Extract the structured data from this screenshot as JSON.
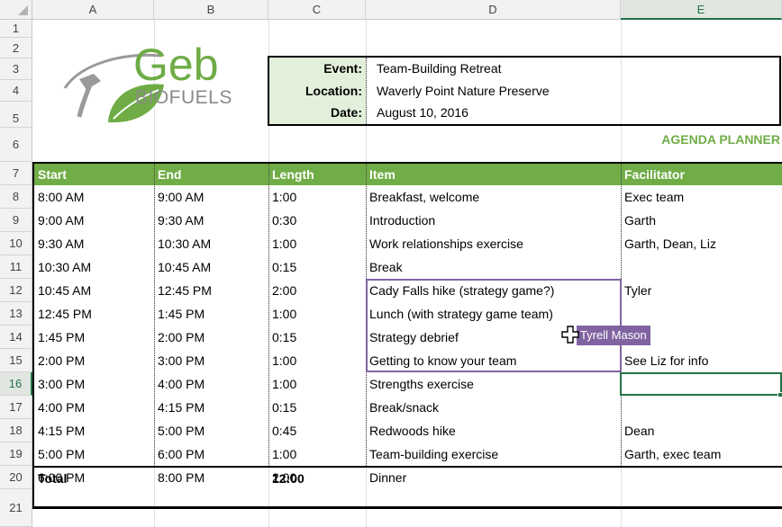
{
  "columns": [
    "A",
    "B",
    "C",
    "D",
    "E"
  ],
  "rows": [
    "1",
    "2",
    "3",
    "4",
    "5",
    "6",
    "7",
    "8",
    "9",
    "10",
    "11",
    "12",
    "13",
    "14",
    "15",
    "16",
    "17",
    "18",
    "19",
    "20",
    "21"
  ],
  "logo": {
    "main": "Geb",
    "sub": "BIOFUELS"
  },
  "event_info": {
    "event_label": "Event:",
    "event_value": "Team-Building Retreat",
    "location_label": "Location:",
    "location_value": "Waverly Point Nature Preserve",
    "date_label": "Date:",
    "date_value": "August 10, 2016"
  },
  "agenda_title": "AGENDA PLANNER",
  "table_headers": [
    "Start",
    "End",
    "Length",
    "Item",
    "Facilitator"
  ],
  "agenda": [
    [
      "8:00 AM",
      "9:00 AM",
      "1:00",
      "Breakfast, welcome",
      "Exec team"
    ],
    [
      "9:00 AM",
      "9:30 AM",
      "0:30",
      "Introduction",
      "Garth"
    ],
    [
      "9:30 AM",
      "10:30 AM",
      "1:00",
      "Work relationships exercise",
      "Garth, Dean, Liz"
    ],
    [
      "10:30 AM",
      "10:45 AM",
      "0:15",
      "Break",
      ""
    ],
    [
      "10:45 AM",
      "12:45 PM",
      "2:00",
      "Cady Falls hike (strategy game?)",
      "Tyler"
    ],
    [
      "12:45 PM",
      "1:45 PM",
      "1:00",
      "Lunch (with strategy game team)",
      ""
    ],
    [
      "1:45 PM",
      "2:00 PM",
      "0:15",
      "Strategy debrief",
      ""
    ],
    [
      "2:00 PM",
      "3:00 PM",
      "1:00",
      "Getting to know your team",
      "See Liz for info"
    ],
    [
      "3:00 PM",
      "4:00 PM",
      "1:00",
      "Strengths exercise",
      ""
    ],
    [
      "4:00 PM",
      "4:15 PM",
      "0:15",
      "Break/snack",
      ""
    ],
    [
      "4:15 PM",
      "5:00 PM",
      "0:45",
      "Redwoods hike",
      "Dean"
    ],
    [
      "5:00 PM",
      "6:00 PM",
      "1:00",
      "Team-building exercise",
      "Garth, exec team"
    ],
    [
      "6:00 PM",
      "8:00 PM",
      "2:00",
      "Dinner",
      ""
    ]
  ],
  "total": {
    "label": "Total",
    "length": "12:00"
  },
  "collab_tag": "Tyrell Mason",
  "colors": {
    "header_green": "#71ad47",
    "title_green": "#70ad47",
    "label_fill": "#e2efda",
    "collab_purple": "#8064a2",
    "select_green": "#217346"
  }
}
